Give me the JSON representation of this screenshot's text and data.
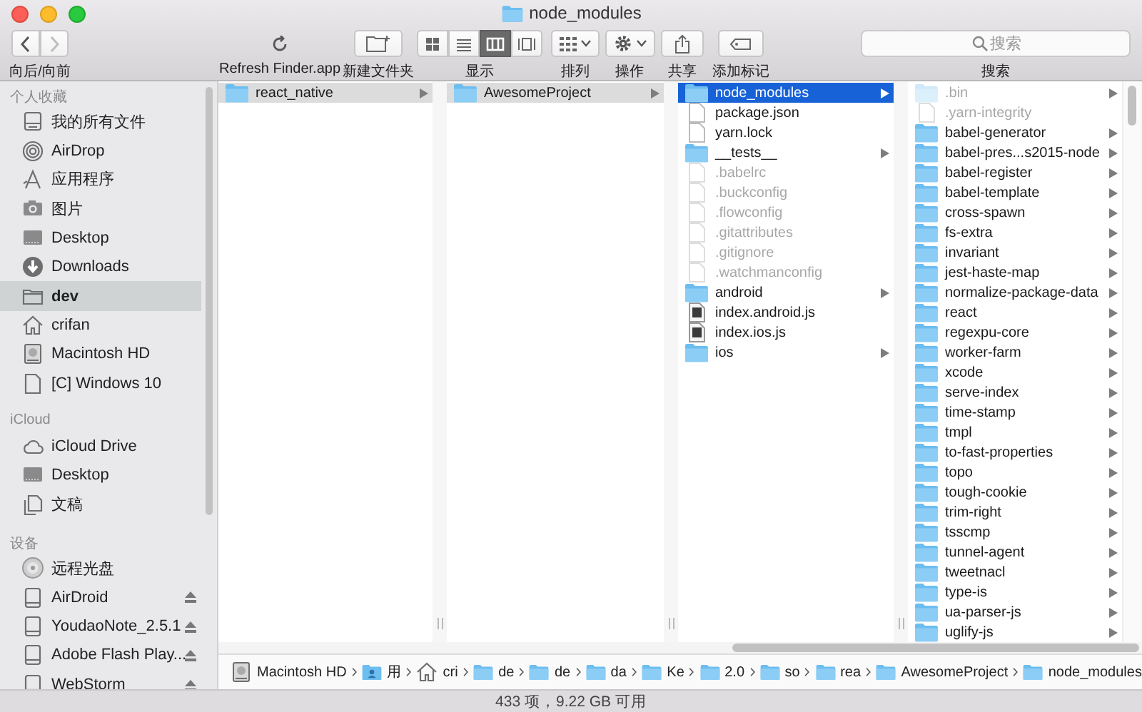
{
  "window": {
    "title": "node_modules"
  },
  "toolbar": [
    {
      "kind": "nav",
      "label": "向后/向前",
      "forward_disabled": true
    },
    {
      "kind": "refresh",
      "label": "Refresh Finder.app"
    },
    {
      "kind": "new-folder",
      "label": "新建文件夹"
    },
    {
      "kind": "view",
      "label": "显示",
      "modes": [
        {
          "selected": false
        },
        {
          "selected": false
        },
        {
          "selected": true
        },
        {
          "selected": false
        }
      ]
    },
    {
      "kind": "arrange",
      "label": "排列"
    },
    {
      "kind": "action",
      "label": "操作"
    },
    {
      "kind": "share",
      "label": "共享"
    },
    {
      "kind": "tag",
      "label": "添加标记"
    },
    {
      "kind": "search",
      "label": "搜索",
      "placeholder": "搜索"
    }
  ],
  "sidebar": [
    {
      "heading": "个人收藏",
      "items": [
        {
          "label": "我的所有文件",
          "kind": "all-files",
          "selected": false
        },
        {
          "label": "AirDrop",
          "kind": "airdrop",
          "selected": false
        },
        {
          "label": "应用程序",
          "kind": "applications",
          "selected": false
        },
        {
          "label": "图片",
          "kind": "pictures",
          "selected": false
        },
        {
          "label": "Desktop",
          "kind": "desktop",
          "selected": false
        },
        {
          "label": "Downloads",
          "kind": "downloads",
          "selected": false
        },
        {
          "label": "dev",
          "kind": "folder",
          "selected": true
        },
        {
          "label": "crifan",
          "kind": "home",
          "selected": false
        },
        {
          "label": "Macintosh HD",
          "kind": "disk",
          "selected": false
        },
        {
          "label": "[C] Windows 10",
          "kind": "document",
          "selected": false
        }
      ]
    },
    {
      "heading": "iCloud",
      "items": [
        {
          "label": "iCloud Drive",
          "kind": "cloud",
          "selected": false
        },
        {
          "label": "Desktop",
          "kind": "desktop",
          "selected": false
        },
        {
          "label": "文稿",
          "kind": "documents",
          "selected": false
        }
      ]
    },
    {
      "heading": "设备",
      "items": [
        {
          "label": "远程光盘",
          "kind": "disc",
          "selected": false
        },
        {
          "label": "AirDroid",
          "kind": "external-disk",
          "selected": false,
          "ejectable": true
        },
        {
          "label": "YoudaoNote_2.5.1",
          "kind": "external-disk",
          "selected": false,
          "ejectable": true
        },
        {
          "label": "Adobe Flash Play...",
          "kind": "external-disk",
          "selected": false,
          "ejectable": true
        },
        {
          "label": "WebStorm",
          "kind": "external-disk",
          "selected": false,
          "ejectable": true
        }
      ]
    }
  ],
  "columns": [
    {
      "rows": [
        {
          "name": "react_native",
          "kind": "folder",
          "selected": true,
          "active": false,
          "has_children": true
        }
      ]
    },
    {
      "rows": [
        {
          "name": "AwesomeProject",
          "kind": "folder",
          "selected": true,
          "active": false,
          "has_children": true
        }
      ]
    },
    {
      "rows": [
        {
          "name": "node_modules",
          "kind": "folder",
          "selected": true,
          "active": true,
          "has_children": true
        },
        {
          "name": "package.json",
          "kind": "file",
          "selected": false,
          "has_children": false
        },
        {
          "name": "yarn.lock",
          "kind": "file",
          "selected": false,
          "has_children": false
        },
        {
          "name": "__tests__",
          "kind": "folder",
          "selected": false,
          "has_children": true
        },
        {
          "name": ".babelrc",
          "kind": "file",
          "selected": false,
          "hidden": true,
          "has_children": false
        },
        {
          "name": ".buckconfig",
          "kind": "file",
          "selected": false,
          "hidden": true,
          "has_children": false
        },
        {
          "name": ".flowconfig",
          "kind": "file",
          "selected": false,
          "hidden": true,
          "has_children": false
        },
        {
          "name": ".gitattributes",
          "kind": "file",
          "selected": false,
          "hidden": true,
          "has_children": false
        },
        {
          "name": ".gitignore",
          "kind": "file",
          "selected": false,
          "hidden": true,
          "has_children": false
        },
        {
          "name": ".watchmanconfig",
          "kind": "file",
          "selected": false,
          "hidden": true,
          "has_children": false
        },
        {
          "name": "android",
          "kind": "folder",
          "selected": false,
          "has_children": true
        },
        {
          "name": "index.android.js",
          "kind": "script",
          "selected": false,
          "has_children": false
        },
        {
          "name": "index.ios.js",
          "kind": "script",
          "selected": false,
          "has_children": false
        },
        {
          "name": "ios",
          "kind": "folder",
          "selected": false,
          "has_children": true
        }
      ]
    },
    {
      "rows": [
        {
          "name": ".bin",
          "kind": "folder",
          "selected": false,
          "hidden": true,
          "has_children": true
        },
        {
          "name": ".yarn-integrity",
          "kind": "file",
          "selected": false,
          "hidden": true,
          "has_children": false
        },
        {
          "name": "babel-generator",
          "kind": "folder",
          "selected": false,
          "has_children": true
        },
        {
          "name": "babel-pres...s2015-node",
          "kind": "folder",
          "selected": false,
          "has_children": true
        },
        {
          "name": "babel-register",
          "kind": "folder",
          "selected": false,
          "has_children": true
        },
        {
          "name": "babel-template",
          "kind": "folder",
          "selected": false,
          "has_children": true
        },
        {
          "name": "cross-spawn",
          "kind": "folder",
          "selected": false,
          "has_children": true
        },
        {
          "name": "fs-extra",
          "kind": "folder",
          "selected": false,
          "has_children": true
        },
        {
          "name": "invariant",
          "kind": "folder",
          "selected": false,
          "has_children": true
        },
        {
          "name": "jest-haste-map",
          "kind": "folder",
          "selected": false,
          "has_children": true
        },
        {
          "name": "normalize-package-data",
          "kind": "folder",
          "selected": false,
          "has_children": true
        },
        {
          "name": "react",
          "kind": "folder",
          "selected": false,
          "has_children": true
        },
        {
          "name": "regexpu-core",
          "kind": "folder",
          "selected": false,
          "has_children": true
        },
        {
          "name": "worker-farm",
          "kind": "folder",
          "selected": false,
          "has_children": true
        },
        {
          "name": "xcode",
          "kind": "folder",
          "selected": false,
          "has_children": true
        },
        {
          "name": "serve-index",
          "kind": "folder",
          "selected": false,
          "has_children": true
        },
        {
          "name": "time-stamp",
          "kind": "folder",
          "selected": false,
          "has_children": true
        },
        {
          "name": "tmpl",
          "kind": "folder",
          "selected": false,
          "has_children": true
        },
        {
          "name": "to-fast-properties",
          "kind": "folder",
          "selected": false,
          "has_children": true
        },
        {
          "name": "topo",
          "kind": "folder",
          "selected": false,
          "has_children": true
        },
        {
          "name": "tough-cookie",
          "kind": "folder",
          "selected": false,
          "has_children": true
        },
        {
          "name": "trim-right",
          "kind": "folder",
          "selected": false,
          "has_children": true
        },
        {
          "name": "tsscmp",
          "kind": "folder",
          "selected": false,
          "has_children": true
        },
        {
          "name": "tunnel-agent",
          "kind": "folder",
          "selected": false,
          "has_children": true
        },
        {
          "name": "tweetnacl",
          "kind": "folder",
          "selected": false,
          "has_children": true
        },
        {
          "name": "type-is",
          "kind": "folder",
          "selected": false,
          "has_children": true
        },
        {
          "name": "ua-parser-js",
          "kind": "folder",
          "selected": false,
          "has_children": true
        },
        {
          "name": "uglify-js",
          "kind": "folder",
          "selected": false,
          "has_children": true
        }
      ]
    }
  ],
  "path_bar": [
    {
      "label": "Macintosh HD",
      "kind": "disk"
    },
    {
      "label": "用",
      "kind": "user-folder"
    },
    {
      "label": "cri",
      "kind": "home"
    },
    {
      "label": "de",
      "kind": "folder"
    },
    {
      "label": "de",
      "kind": "folder"
    },
    {
      "label": "da",
      "kind": "folder"
    },
    {
      "label": "Ke",
      "kind": "folder"
    },
    {
      "label": "2.0",
      "kind": "folder"
    },
    {
      "label": "so",
      "kind": "folder"
    },
    {
      "label": "rea",
      "kind": "folder"
    },
    {
      "label": "AwesomeProject",
      "kind": "folder"
    },
    {
      "label": "node_modules",
      "kind": "folder"
    }
  ],
  "status_bar": "433 项，9.22 GB 可用"
}
